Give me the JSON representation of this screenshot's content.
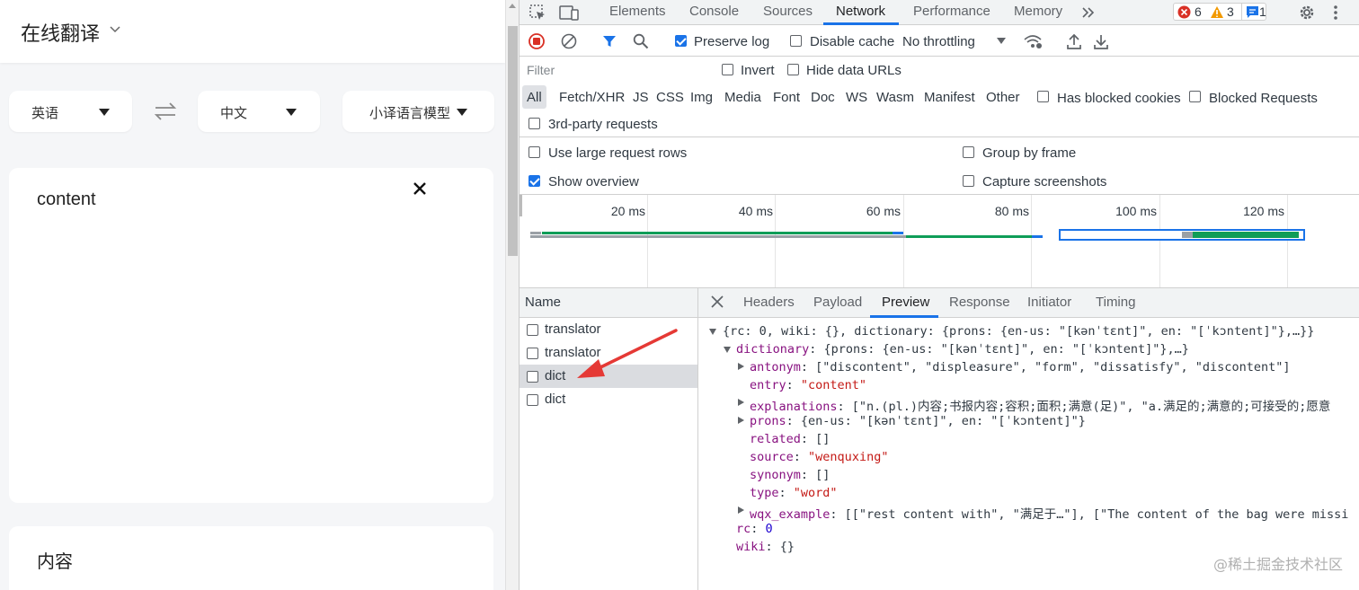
{
  "app": {
    "title": "在线翻译",
    "source_lang": "英语",
    "target_lang": "中文",
    "model": "小译语言模型",
    "input_text": "content",
    "output_text": "内容"
  },
  "devtools": {
    "tabs": [
      "Elements",
      "Console",
      "Sources",
      "Network",
      "Performance",
      "Memory"
    ],
    "active_tab": "Network",
    "badges": {
      "errors": "6",
      "warnings": "3",
      "messages": "1"
    },
    "toolbar": {
      "preserve_log": "Preserve log",
      "disable_cache": "Disable cache",
      "throttling": "No throttling"
    },
    "filter": {
      "placeholder": "Filter",
      "invert": "Invert",
      "hide_data_urls": "Hide data URLs"
    },
    "types": [
      "All",
      "Fetch/XHR",
      "JS",
      "CSS",
      "Img",
      "Media",
      "Font",
      "Doc",
      "WS",
      "Wasm",
      "Manifest",
      "Other"
    ],
    "has_blocked_cookies": "Has blocked cookies",
    "blocked_requests": "Blocked Requests",
    "third_party": "3rd-party requests",
    "settings": {
      "large_rows": "Use large request rows",
      "group_by_frame": "Group by frame",
      "show_overview": "Show overview",
      "capture_screenshots": "Capture screenshots"
    },
    "overview_ticks": [
      "20 ms",
      "40 ms",
      "60 ms",
      "80 ms",
      "100 ms",
      "120 ms"
    ],
    "name_header": "Name",
    "requests": [
      "translator",
      "translator",
      "dict",
      "dict"
    ],
    "selected_request": 2,
    "detail_tabs": [
      "Headers",
      "Payload",
      "Preview",
      "Response",
      "Initiator",
      "Timing"
    ],
    "active_detail_tab": "Preview",
    "preview": {
      "l0": "{rc: 0, wiki: {}, dictionary: {prons: {en-us: \"[kənˈtɛnt]\", en: \"[ˈkɔntent]\"},…}}",
      "l1_key": "dictionary",
      "l1_val": ": {prons: {en-us: \"[kənˈtɛnt]\", en: \"[ˈkɔntent]\"},…}",
      "antonym_key": "antonym",
      "antonym_val": ": [\"discontent\", \"displeasure\", \"form\", \"dissatisfy\", \"discontent\"]",
      "entry_key": "entry",
      "entry_val": "\"content\"",
      "explanations_key": "explanations",
      "explanations_val": ": [\"n.(pl.)内容;书报内容;容积;面积;满意(足)\", \"a.满足的;满意的;可接受的;愿意",
      "prons_key": "prons",
      "prons_val": ": {en-us: \"[kənˈtɛnt]\", en: \"[ˈkɔntent]\"}",
      "related_key": "related",
      "related_val": ": []",
      "source_key": "source",
      "source_val": "\"wenquxing\"",
      "synonym_key": "synonym",
      "synonym_val": ": []",
      "type_key": "type",
      "type_val": "\"word\"",
      "wqx_key": "wqx_example",
      "wqx_val": ": [[\"rest content with\", \"满足于…\"], [\"The content of the bag were missi",
      "rc_key": "rc",
      "rc_val": "0",
      "wiki_key": "wiki",
      "wiki_val": ": {}"
    }
  },
  "watermark": "@稀土掘金技术社区",
  "colors": {
    "accent": "#1a73e8",
    "arrow": "#e53935",
    "record": "#d93025"
  }
}
